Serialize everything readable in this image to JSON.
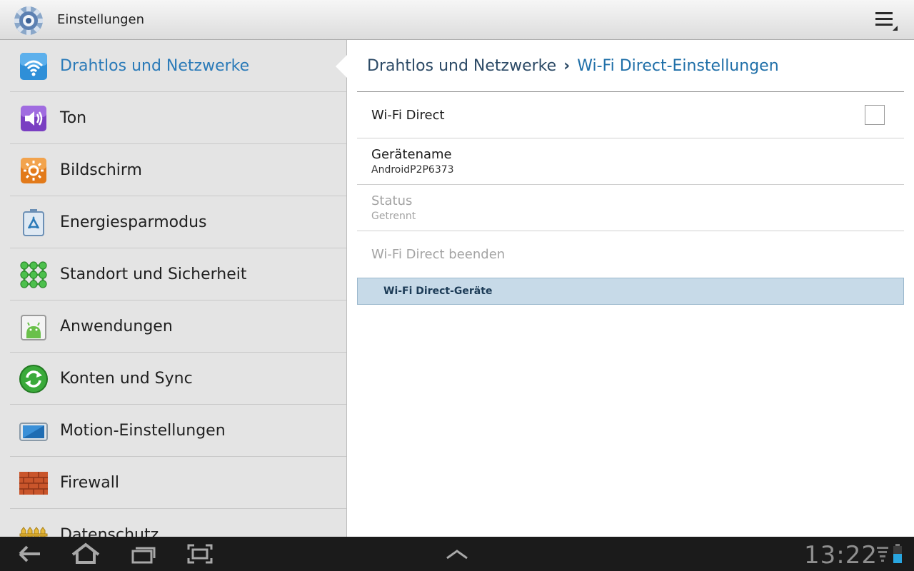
{
  "app": {
    "title": "Einstellungen"
  },
  "categories": [
    {
      "label": "Drahtlos und Netzwerke",
      "icon": "wifi-icon",
      "selected": true
    },
    {
      "label": "Ton",
      "icon": "speaker-icon"
    },
    {
      "label": "Bildschirm",
      "icon": "brightness-icon"
    },
    {
      "label": "Energiesparmodus",
      "icon": "battery-recycle-icon"
    },
    {
      "label": "Standort und Sicherheit",
      "icon": "location-grid-icon"
    },
    {
      "label": "Anwendungen",
      "icon": "android-app-icon"
    },
    {
      "label": "Konten und Sync",
      "icon": "sync-icon"
    },
    {
      "label": "Motion-Einstellungen",
      "icon": "tablet-motion-icon"
    },
    {
      "label": "Firewall",
      "icon": "brick-wall-icon"
    },
    {
      "label": "Datenschutz",
      "icon": "fence-icon"
    }
  ],
  "breadcrumb": {
    "parent": "Drahtlos und Netzwerke",
    "separator": "›",
    "current": "Wi-Fi Direct-Einstellungen"
  },
  "prefs": {
    "wifi_direct": {
      "title": "Wi-Fi Direct",
      "checked": false
    },
    "device_name": {
      "title": "Gerätename",
      "summary": "AndroidP2P6373"
    },
    "status": {
      "title": "Status",
      "summary": "Getrennt",
      "enabled": false
    },
    "end_wifi_direct": {
      "title": "Wi-Fi Direct beenden",
      "enabled": false
    }
  },
  "devices_header": {
    "label": "Wi-Fi Direct-Geräte"
  },
  "statusbar": {
    "time": "13:22"
  },
  "colors": {
    "accent": "#2a7ab8",
    "category_header": "#c7dae8",
    "system_bar": "#1b1b1b"
  }
}
